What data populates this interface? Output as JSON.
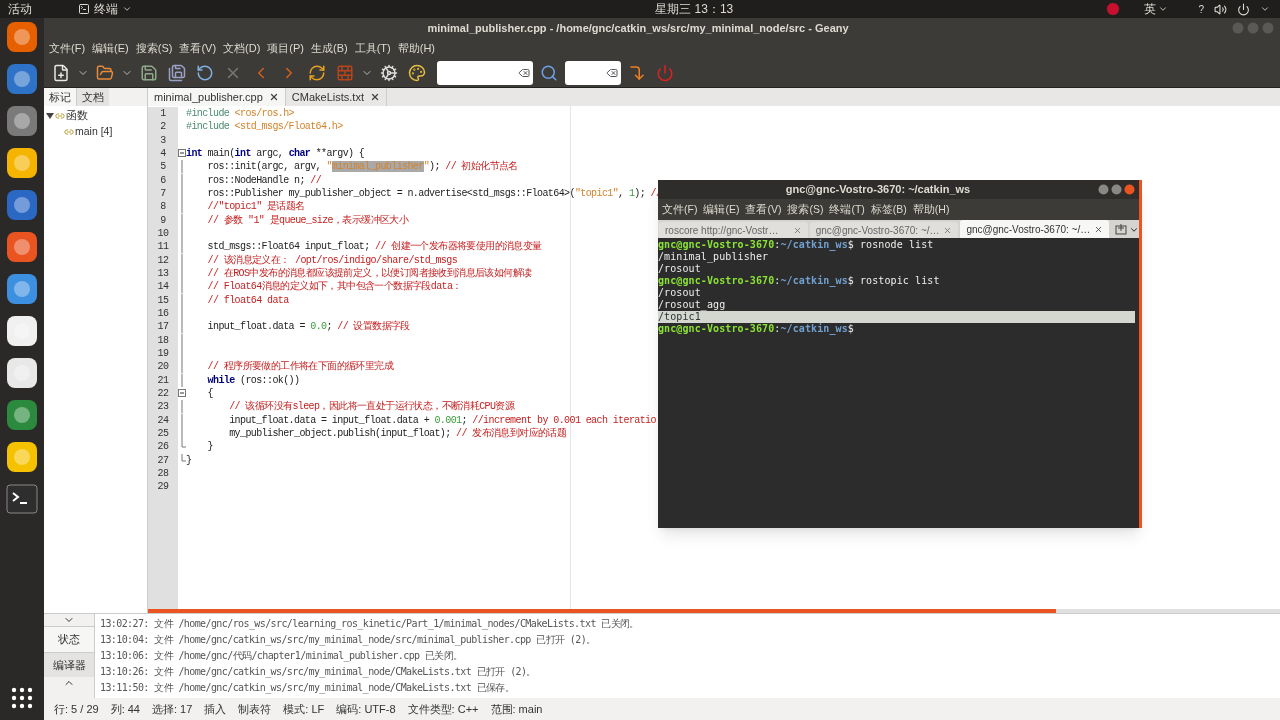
{
  "top_bar": {
    "activities": "活动",
    "app_menu": "终端",
    "clock": "星期三 13：13",
    "input_method": "英",
    "help": "?"
  },
  "geany": {
    "title": "minimal_publisher.cpp - /home/gnc/catkin_ws/src/my_minimal_node/src - Geany",
    "menu": [
      "文件(F)",
      "编辑(E)",
      "搜索(S)",
      "查看(V)",
      "文档(D)",
      "项目(P)",
      "生成(B)",
      "工具(T)",
      "帮助(H)"
    ],
    "sidebar": {
      "tabs": [
        {
          "label": "标记",
          "selected": true
        },
        {
          "label": "文档",
          "selected": false
        }
      ],
      "tree": [
        {
          "label": "函数",
          "expanded": true,
          "children": [
            {
              "label": "main [4]"
            }
          ]
        }
      ]
    },
    "editor_tabs": [
      {
        "label": "minimal_publisher.cpp",
        "selected": true
      },
      {
        "label": "CMakeLists.txt",
        "selected": false
      }
    ],
    "code": [
      {
        "number": "1",
        "in_fold": false,
        "fold_end": false,
        "tokens": [
          {
            "kind": "pp",
            "text": "#include "
          },
          {
            "kind": "str",
            "text": "<ros/ros.h>"
          }
        ]
      },
      {
        "number": "2",
        "in_fold": false,
        "fold_end": false,
        "tokens": [
          {
            "kind": "pp",
            "text": "#include "
          },
          {
            "kind": "str",
            "text": "<std_msgs/Float64.h>"
          }
        ]
      },
      {
        "number": "3",
        "in_fold": false,
        "fold_end": false
      },
      {
        "number": "4",
        "fold_expanded": true,
        "tokens": [
          {
            "kind": "kw",
            "text": "int"
          },
          {
            "kind": "pl",
            "text": " main("
          },
          {
            "kind": "kw",
            "text": "int"
          },
          {
            "kind": "pl",
            "text": " argc, "
          },
          {
            "kind": "kw",
            "text": "char"
          },
          {
            "kind": "pl",
            "text": " **argv) {"
          }
        ]
      },
      {
        "number": "5",
        "in_fold": true,
        "fold_end": false,
        "tokens": [
          {
            "kind": "pl",
            "text": "    ros::init(argc, argv, "
          },
          {
            "kind": "str",
            "text": "\""
          },
          {
            "kind": "sel",
            "text": "minimal_publisher"
          },
          {
            "kind": "str",
            "text": "\""
          },
          {
            "kind": "pl",
            "text": "); "
          },
          {
            "kind": "cm",
            "text": "// 初始化节点名"
          }
        ]
      },
      {
        "number": "6",
        "in_fold": true,
        "fold_end": false,
        "tokens": [
          {
            "kind": "pl",
            "text": "    ros::NodeHandle n; "
          },
          {
            "kind": "cm",
            "text": "//"
          }
        ]
      },
      {
        "number": "7",
        "in_fold": true,
        "fold_end": false,
        "tokens": [
          {
            "kind": "pl",
            "text": "    ros::Publisher my_publisher_object = n.advertise<std_msgs::Float64>("
          },
          {
            "kind": "str",
            "text": "\"topic1\""
          },
          {
            "kind": "pl",
            "text": ", "
          },
          {
            "kind": "num",
            "text": "1"
          },
          {
            "kind": "pl",
            "text": "); "
          },
          {
            "kind": "cm",
            "text": "//"
          }
        ]
      },
      {
        "number": "8",
        "in_fold": true,
        "fold_end": false,
        "tokens": [
          {
            "kind": "cm",
            "text": "    //\"topic1\" 是话题名"
          }
        ]
      },
      {
        "number": "9",
        "in_fold": true,
        "fold_end": false,
        "tokens": [
          {
            "kind": "cm",
            "text": "    // 参数 \"1\" 是queue_size，表示缓冲区大小"
          }
        ]
      },
      {
        "number": "10",
        "in_fold": true,
        "fold_end": false
      },
      {
        "number": "11",
        "in_fold": true,
        "fold_end": false,
        "tokens": [
          {
            "kind": "pl",
            "text": "    std_msgs::Float64 input_float; "
          },
          {
            "kind": "cm",
            "text": "// 创建一个发布器将要使用的消息变量"
          }
        ]
      },
      {
        "number": "12",
        "in_fold": true,
        "fold_end": false,
        "tokens": [
          {
            "kind": "cm",
            "text": "    // 该消息定义在： /opt/ros/indigo/share/std_msgs"
          }
        ]
      },
      {
        "number": "13",
        "in_fold": true,
        "fold_end": false,
        "tokens": [
          {
            "kind": "cm",
            "text": "    // 在ROS中发布的消息都应该提前定义，以便订阅者接收到消息后该如何解读"
          }
        ]
      },
      {
        "number": "14",
        "in_fold": true,
        "fold_end": false,
        "tokens": [
          {
            "kind": "cm",
            "text": "    // Float64消息的定义如下，其中包含一个数据字段data："
          }
        ]
      },
      {
        "number": "15",
        "in_fold": true,
        "fold_end": false,
        "tokens": [
          {
            "kind": "cm",
            "text": "    // float64 data"
          }
        ]
      },
      {
        "number": "16",
        "in_fold": true,
        "fold_end": false
      },
      {
        "number": "17",
        "in_fold": true,
        "fold_end": false,
        "tokens": [
          {
            "kind": "pl",
            "text": "    input_float.data = "
          },
          {
            "kind": "num",
            "text": "0.0"
          },
          {
            "kind": "pl",
            "text": "; "
          },
          {
            "kind": "cm",
            "text": "// 设置数据字段"
          }
        ]
      },
      {
        "number": "18",
        "in_fold": true,
        "fold_end": false
      },
      {
        "number": "19",
        "in_fold": true,
        "fold_end": false
      },
      {
        "number": "20",
        "in_fold": true,
        "fold_end": false,
        "tokens": [
          {
            "kind": "cm",
            "text": "    // 程序所要做的工作将在下面的循环里完成"
          }
        ]
      },
      {
        "number": "21",
        "in_fold": true,
        "fold_end": false,
        "tokens": [
          {
            "kind": "kw",
            "text": "    while"
          },
          {
            "kind": "pl",
            "text": " (ros::ok())"
          }
        ]
      },
      {
        "number": "22",
        "fold_expanded": true,
        "tokens": [
          {
            "kind": "pl",
            "text": "    {"
          }
        ]
      },
      {
        "number": "23",
        "in_fold": true,
        "fold_end": false,
        "tokens": [
          {
            "kind": "cm",
            "text": "        // 该循环没有sleep，因此将一直处于运行状态，不断消耗CPU资源"
          }
        ]
      },
      {
        "number": "24",
        "in_fold": true,
        "fold_end": false,
        "tokens": [
          {
            "kind": "pl",
            "text": "        input_float.data = input_float.data + "
          },
          {
            "kind": "num",
            "text": "0.001"
          },
          {
            "kind": "pl",
            "text": "; "
          },
          {
            "kind": "cm",
            "text": "//increment by 0.001 each iteratio"
          }
        ]
      },
      {
        "number": "25",
        "in_fold": true,
        "fold_end": false,
        "tokens": [
          {
            "kind": "pl",
            "text": "        my_publisher_object.publish(input_float); "
          },
          {
            "kind": "cm",
            "text": "// 发布消息到对应的话题"
          }
        ]
      },
      {
        "number": "26",
        "fold_end": true,
        "tokens": [
          {
            "kind": "pl",
            "text": "    }"
          }
        ]
      },
      {
        "number": "27",
        "fold_end": true,
        "tokens": [
          {
            "kind": "pl",
            "text": "}"
          }
        ]
      },
      {
        "number": "28",
        "in_fold": false,
        "fold_end": false
      },
      {
        "number": "29",
        "in_fold": false,
        "fold_end": false
      }
    ],
    "messages": {
      "tabs": [
        {
          "label": "状态",
          "selected": true
        },
        {
          "label": "编译器",
          "selected": false
        }
      ],
      "lines": [
        "13:02:27: 文件 /home/gnc/ros_ws/src/learning_ros_kinetic/Part_1/minimal_nodes/CMakeLists.txt 已关闭。",
        "13:10:04: 文件 /home/gnc/catkin_ws/src/my_minimal_node/src/minimal_publisher.cpp 已打开 (2)。",
        "13:10:06: 文件 /home/gnc/代码/chapter1/minimal_publisher.cpp 已关闭。",
        "13:10:26: 文件 /home/gnc/catkin_ws/src/my_minimal_node/CMakeLists.txt 已打开 (2)。",
        "13:11:50: 文件 /home/gnc/catkin_ws/src/my_minimal_node/CMakeLists.txt 已保存。"
      ]
    },
    "status_bar": [
      "行: 5 / 29",
      "列: 44",
      "选择: 17",
      "插入",
      "制表符",
      "模式: LF",
      "编码: UTF-8",
      "文件类型: C++",
      "范围: main"
    ]
  },
  "terminal": {
    "title": "gnc@gnc-Vostro-3670: ~/catkin_ws",
    "menu": [
      "文件(F)",
      "编辑(E)",
      "查看(V)",
      "搜索(S)",
      "终端(T)",
      "标签(B)",
      "帮助(H)"
    ],
    "tabs": [
      {
        "label": "roscore http://gnc-Vostr…",
        "selected": false
      },
      {
        "label": "gnc@gnc-Vostro-3670: ~/…",
        "selected": false
      },
      {
        "label": "gnc@gnc-Vostro-3670: ~/…",
        "selected": true
      }
    ],
    "lines": [
      {
        "kind": "prompt",
        "user": "gnc@gnc-Vostro-3670",
        "sep": ":",
        "path": "~/catkin_ws",
        "command": "$ rosnode list"
      },
      {
        "kind": "output",
        "text": "/minimal_publisher",
        "selected": false
      },
      {
        "kind": "output",
        "text": "/rosout",
        "selected": false
      },
      {
        "kind": "prompt",
        "user": "gnc@gnc-Vostro-3670",
        "sep": ":",
        "path": "~/catkin_ws",
        "command": "$ rostopic list"
      },
      {
        "kind": "output",
        "text": "/rosout",
        "selected": false
      },
      {
        "kind": "output",
        "text": "/rosout_agg",
        "selected": false
      },
      {
        "kind": "output",
        "text": "/topic1",
        "selected": true
      },
      {
        "kind": "prompt",
        "user": "gnc@gnc-Vostro-3670",
        "sep": ":",
        "path": "~/catkin_ws",
        "command": "$"
      }
    ]
  }
}
